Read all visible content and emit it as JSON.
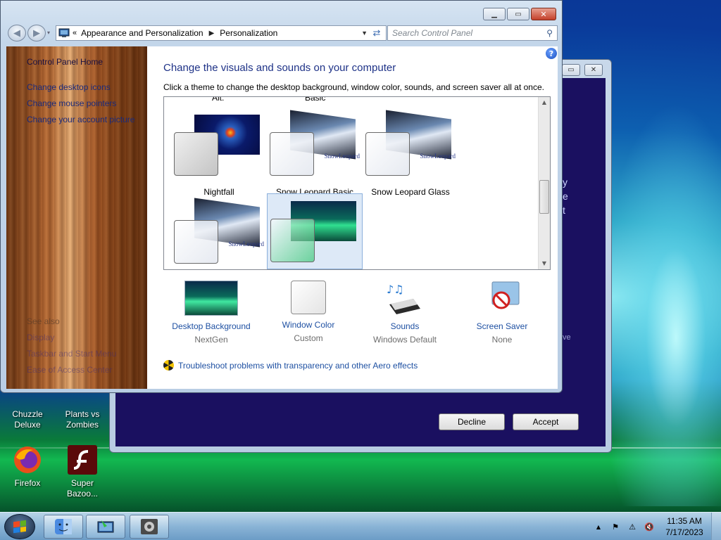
{
  "window": {
    "breadcrumb": [
      "Appearance and Personalization",
      "Personalization"
    ],
    "search_placeholder": "Search Control Panel"
  },
  "sidebar": {
    "home": "Control Panel Home",
    "links": [
      "Change desktop icons",
      "Change mouse pointers",
      "Change your account picture"
    ],
    "see_also_title": "See also",
    "see_also": [
      "Display",
      "Taskbar and Start Menu",
      "Ease of Access Center"
    ]
  },
  "content": {
    "heading": "Change the visuals and sounds on your computer",
    "subtext": "Click a theme to change the desktop background, window color, sounds, and screen saver all at once.",
    "cut_labels": [
      "Alt.",
      "Basic"
    ],
    "themes": [
      {
        "label": "Nightfall",
        "brand": ""
      },
      {
        "label": "Snow Leopard Basic",
        "brand": "SnowLeopard"
      },
      {
        "label": "Snow Leopard Glass",
        "brand": "SnowLeopard"
      },
      {
        "label": "",
        "brand": "SnowLeopard"
      },
      {
        "label": "",
        "brand": ""
      }
    ],
    "settings": [
      {
        "label": "Desktop Background",
        "value": "NextGen"
      },
      {
        "label": "Window Color",
        "value": "Custom"
      },
      {
        "label": "Sounds",
        "value": "Windows Default"
      },
      {
        "label": "Screen Saver",
        "value": "None"
      }
    ],
    "troubleshoot": "Troubleshoot problems with transparency and other Aero effects"
  },
  "background_dialog": {
    "decline": "Decline",
    "accept": "Accept",
    "side_text": [
      "y",
      "e",
      "t"
    ],
    "side_text_low": "ve"
  },
  "desktop_icons": [
    {
      "label": "Chuzzle Deluxe"
    },
    {
      "label": "Plants vs Zombies"
    },
    {
      "label": "Firefox"
    },
    {
      "label": "Super Bazoo..."
    }
  ],
  "taskbar": {
    "time": "11:35 AM",
    "date": "7/17/2023"
  },
  "colors": {
    "link": "#1e50a2",
    "heading": "#1e3287",
    "desktop_blue": "#0a3a9a"
  }
}
